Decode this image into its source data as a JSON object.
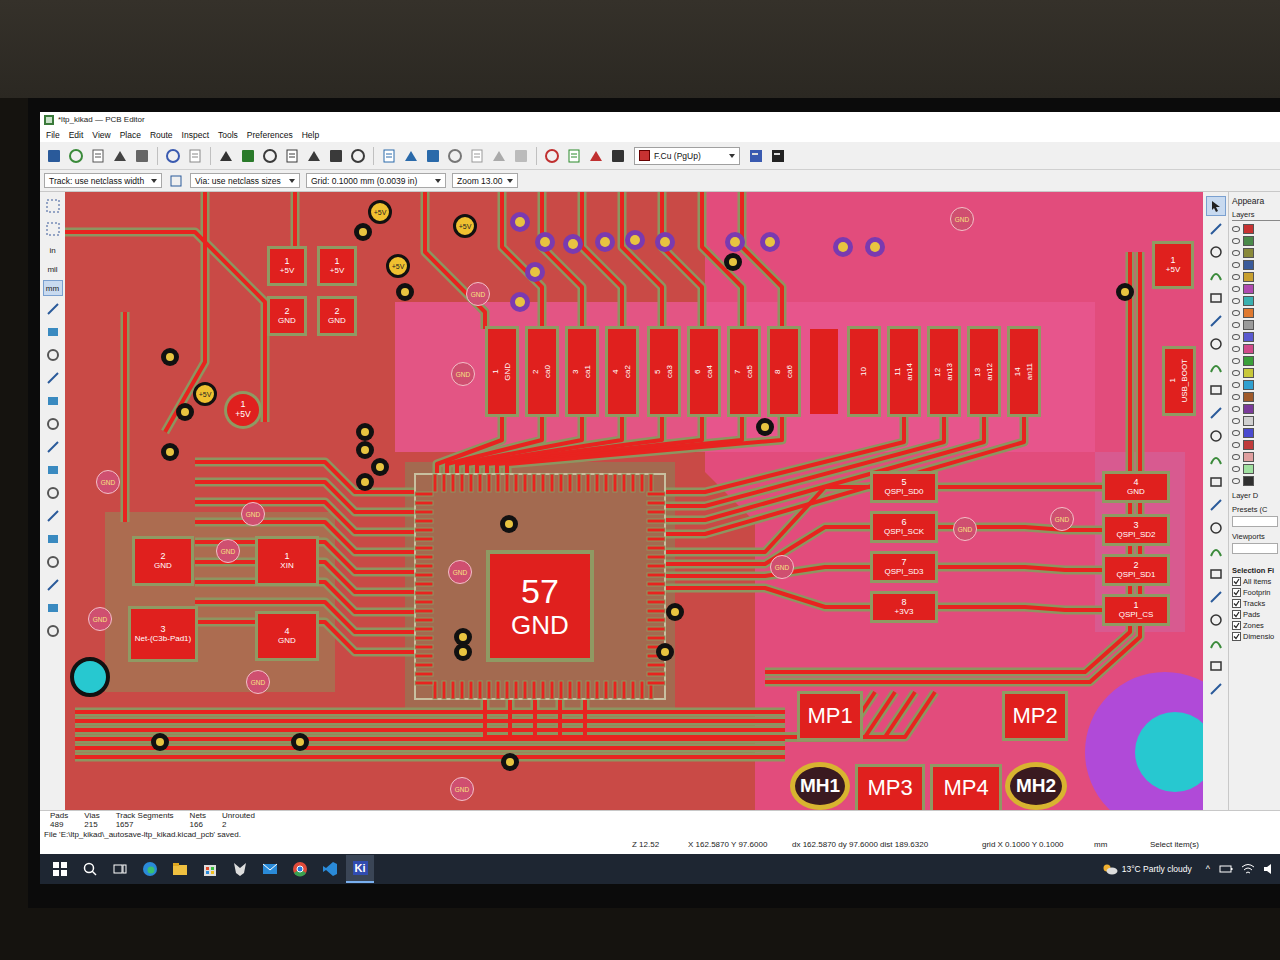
{
  "window": {
    "title": "*ltp_kikad — PCB Editor"
  },
  "menu": [
    "File",
    "Edit",
    "View",
    "Place",
    "Route",
    "Inspect",
    "Tools",
    "Preferences",
    "Help"
  ],
  "toolbar": {
    "layer": "F.Cu (PgUp)",
    "track": "Track: use netclass width",
    "via": "Via: use netclass sizes",
    "grid": "Grid: 0.1000 mm (0.0039 in)",
    "zoom": "Zoom 13.00"
  },
  "units": [
    {
      "label": "in",
      "selected": false
    },
    {
      "label": "mil",
      "selected": false
    },
    {
      "label": "mm",
      "selected": true
    }
  ],
  "pads": [
    {
      "num": "1",
      "net": "GND",
      "kind": "header"
    },
    {
      "num": "2",
      "net": "ca0",
      "kind": "header"
    },
    {
      "num": "3",
      "net": "ca1",
      "kind": "header"
    },
    {
      "num": "4",
      "net": "ca2",
      "kind": "header"
    },
    {
      "num": "5",
      "net": "ca3",
      "kind": "header"
    },
    {
      "num": "6",
      "net": "ca4",
      "kind": "header"
    },
    {
      "num": "7",
      "net": "ca5",
      "kind": "header"
    },
    {
      "num": "8",
      "net": "ca6",
      "kind": "header"
    },
    {
      "num": "10",
      "net": "",
      "kind": "header"
    },
    {
      "num": "11",
      "net": "an14",
      "kind": "header"
    },
    {
      "num": "12",
      "net": "an13",
      "kind": "header"
    },
    {
      "num": "13",
      "net": "an12",
      "kind": "header"
    },
    {
      "num": "14",
      "net": "an11",
      "kind": "header"
    },
    {
      "num": "1",
      "net": "+5V",
      "kind": "smd"
    },
    {
      "num": "1",
      "net": "+5V",
      "kind": "smd"
    },
    {
      "num": "2",
      "net": "GND",
      "kind": "smd"
    },
    {
      "num": "2",
      "net": "GND",
      "kind": "smd"
    },
    {
      "num": "1",
      "net": "+5V",
      "kind": "smd"
    },
    {
      "num": "1",
      "net": "+5V",
      "kind": "round"
    },
    {
      "num": "2",
      "net": "GND",
      "kind": "smd"
    },
    {
      "num": "1",
      "net": "XIN",
      "kind": "smd"
    },
    {
      "num": "3",
      "net": "Net-(C3b-Pad1)",
      "kind": "smd"
    },
    {
      "num": "4",
      "net": "GND",
      "kind": "smd"
    },
    {
      "num": "57",
      "net": "GND",
      "kind": "big"
    },
    {
      "num": "5",
      "net": "QSPI_SD0",
      "kind": "smd"
    },
    {
      "num": "6",
      "net": "QSPI_SCK",
      "kind": "smd"
    },
    {
      "num": "7",
      "net": "QSPI_SD3",
      "kind": "smd"
    },
    {
      "num": "8",
      "net": "+3V3",
      "kind": "smd"
    },
    {
      "num": "4",
      "net": "GND",
      "kind": "smd"
    },
    {
      "num": "3",
      "net": "QSPI_SD2",
      "kind": "smd"
    },
    {
      "num": "2",
      "net": "QSPI_SD1",
      "kind": "smd"
    },
    {
      "num": "1",
      "net": "QSPI_CS",
      "kind": "smd"
    },
    {
      "num": "1",
      "net": "USB_BOOT",
      "kind": "header"
    },
    {
      "num": "MP1",
      "net": "",
      "kind": "label"
    },
    {
      "num": "MP2",
      "net": "",
      "kind": "label"
    },
    {
      "num": "MH1",
      "net": "",
      "kind": "hole"
    },
    {
      "num": "MP3",
      "net": "",
      "kind": "label"
    },
    {
      "num": "MP4",
      "net": "",
      "kind": "label"
    },
    {
      "num": "MH2",
      "net": "",
      "kind": "hole"
    }
  ],
  "vias": [
    {
      "label": "GND",
      "kind": "gnd"
    },
    {
      "label": "GND",
      "kind": "gnd"
    },
    {
      "label": "GND",
      "kind": "gnd"
    },
    {
      "label": "GND",
      "kind": "gnd"
    },
    {
      "label": "GND",
      "kind": "gnd"
    },
    {
      "label": "GND",
      "kind": "gnd"
    },
    {
      "label": "GND",
      "kind": "gnd"
    },
    {
      "label": "GND",
      "kind": "gnd"
    },
    {
      "label": "GND",
      "kind": "gnd"
    },
    {
      "label": "GND",
      "kind": "gnd"
    },
    {
      "label": "GND",
      "kind": "gnd"
    },
    {
      "label": "GND",
      "kind": "gnd"
    },
    {
      "label": "GND",
      "kind": "gnd"
    },
    {
      "label": "+5V",
      "kind": "power"
    },
    {
      "label": "+5V",
      "kind": "power"
    },
    {
      "label": "+5V",
      "kind": "power"
    },
    {
      "label": "+5V",
      "kind": "power"
    }
  ],
  "appearance": {
    "title": "Appeara",
    "tab": "Layers",
    "layer_display": "Layer D",
    "presets": "Presets (C",
    "viewports": "Viewports",
    "selection_title": "Selection Fi",
    "filters": [
      {
        "label": "All items",
        "checked": true
      },
      {
        "label": "Footprin",
        "checked": true
      },
      {
        "label": "Tracks",
        "checked": true
      },
      {
        "label": "Pads",
        "checked": true
      },
      {
        "label": "Zones",
        "checked": true
      },
      {
        "label": "Dimensio",
        "checked": true
      }
    ]
  },
  "stats": [
    {
      "label": "Pads",
      "value": "489"
    },
    {
      "label": "Vias",
      "value": "215"
    },
    {
      "label": "Track Segments",
      "value": "1657"
    },
    {
      "label": "Nets",
      "value": "166"
    },
    {
      "label": "Unrouted",
      "value": "2"
    }
  ],
  "message": "File 'E:\\ltp_kikad\\_autosave-ltp_kikad.kicad_pcb' saved.",
  "status": {
    "zoom": "Z 12.52",
    "position": "X 162.5870 Y 97.6000",
    "delta": "dx 162.5870 dy 97.6000 dist 189.6320",
    "grid": "grid X 0.1000 Y 0.1000",
    "units": "mm",
    "mode": "Select item(s)"
  },
  "taskbar": {
    "apps": [
      {
        "kind": "edge",
        "label": "",
        "active": false
      },
      {
        "kind": "explorer",
        "label": "",
        "active": false
      },
      {
        "kind": "store",
        "label": "",
        "active": false
      },
      {
        "kind": "fox",
        "label": "",
        "active": false
      },
      {
        "kind": "mail",
        "label": "",
        "active": false
      },
      {
        "kind": "chrome",
        "label": "",
        "active": false
      },
      {
        "kind": "vscode",
        "label": "",
        "active": false
      },
      {
        "kind": "kicad",
        "label": "Ki",
        "active": true
      }
    ],
    "weather": "13°C Partly cloudy",
    "tray_arrow": "^"
  }
}
